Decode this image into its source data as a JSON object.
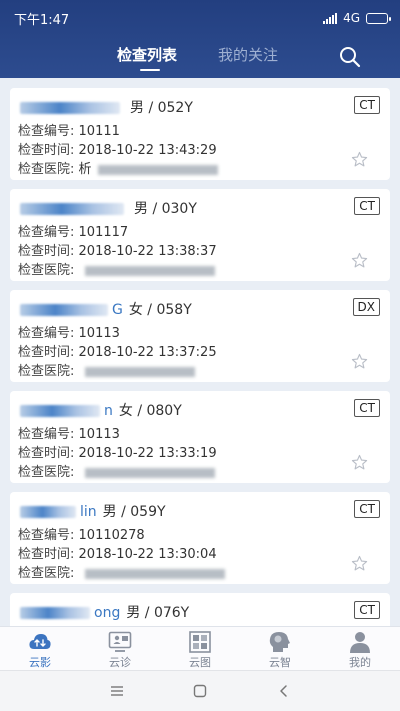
{
  "status_bar": {
    "time": "下午1:47",
    "network": "4G"
  },
  "tabs": [
    {
      "label": "检查列表",
      "active": true
    },
    {
      "label": "我的关注",
      "active": false
    }
  ],
  "labels": {
    "exam_no": "检查编号:",
    "exam_time": "检查时间:",
    "hospital": "检查医院:"
  },
  "records": [
    {
      "name_visible": "",
      "gender_age": "男 / 052Y",
      "modality": "CT",
      "exam_no": "10111",
      "exam_time": "2018-10-22 13:43:29",
      "hospital": "析"
    },
    {
      "name_visible": "",
      "gender_age": "男 / 030Y",
      "modality": "CT",
      "exam_no": "101117",
      "exam_time": "2018-10-22 13:38:37",
      "hospital": ""
    },
    {
      "name_visible": "G",
      "gender_age": "女 / 058Y",
      "modality": "DX",
      "exam_no": "10113",
      "exam_time": "2018-10-22 13:37:25",
      "hospital": ""
    },
    {
      "name_visible": "n",
      "gender_age": "女 / 080Y",
      "modality": "CT",
      "exam_no": "10113",
      "exam_time": "2018-10-22 13:33:19",
      "hospital": ""
    },
    {
      "name_visible": "lin",
      "gender_age": "男 / 059Y",
      "modality": "CT",
      "exam_no": "10110278",
      "exam_time": "2018-10-22 13:30:04",
      "hospital": ""
    },
    {
      "name_visible": "ong",
      "gender_age": "男 / 076Y",
      "modality": "CT",
      "exam_no": "",
      "exam_time": "",
      "hospital": ""
    }
  ],
  "bottom_nav": [
    {
      "label": "云影",
      "icon": "cloud-upload-icon",
      "active": true
    },
    {
      "label": "云诊",
      "icon": "monitor-consult-icon",
      "active": false
    },
    {
      "label": "云图",
      "icon": "image-grid-icon",
      "active": false
    },
    {
      "label": "云智",
      "icon": "brain-head-icon",
      "active": false
    },
    {
      "label": "我的",
      "icon": "user-icon",
      "active": false
    }
  ],
  "colors": {
    "header": "#2a4687",
    "accent": "#3c74c0",
    "background": "#e9eef5"
  }
}
